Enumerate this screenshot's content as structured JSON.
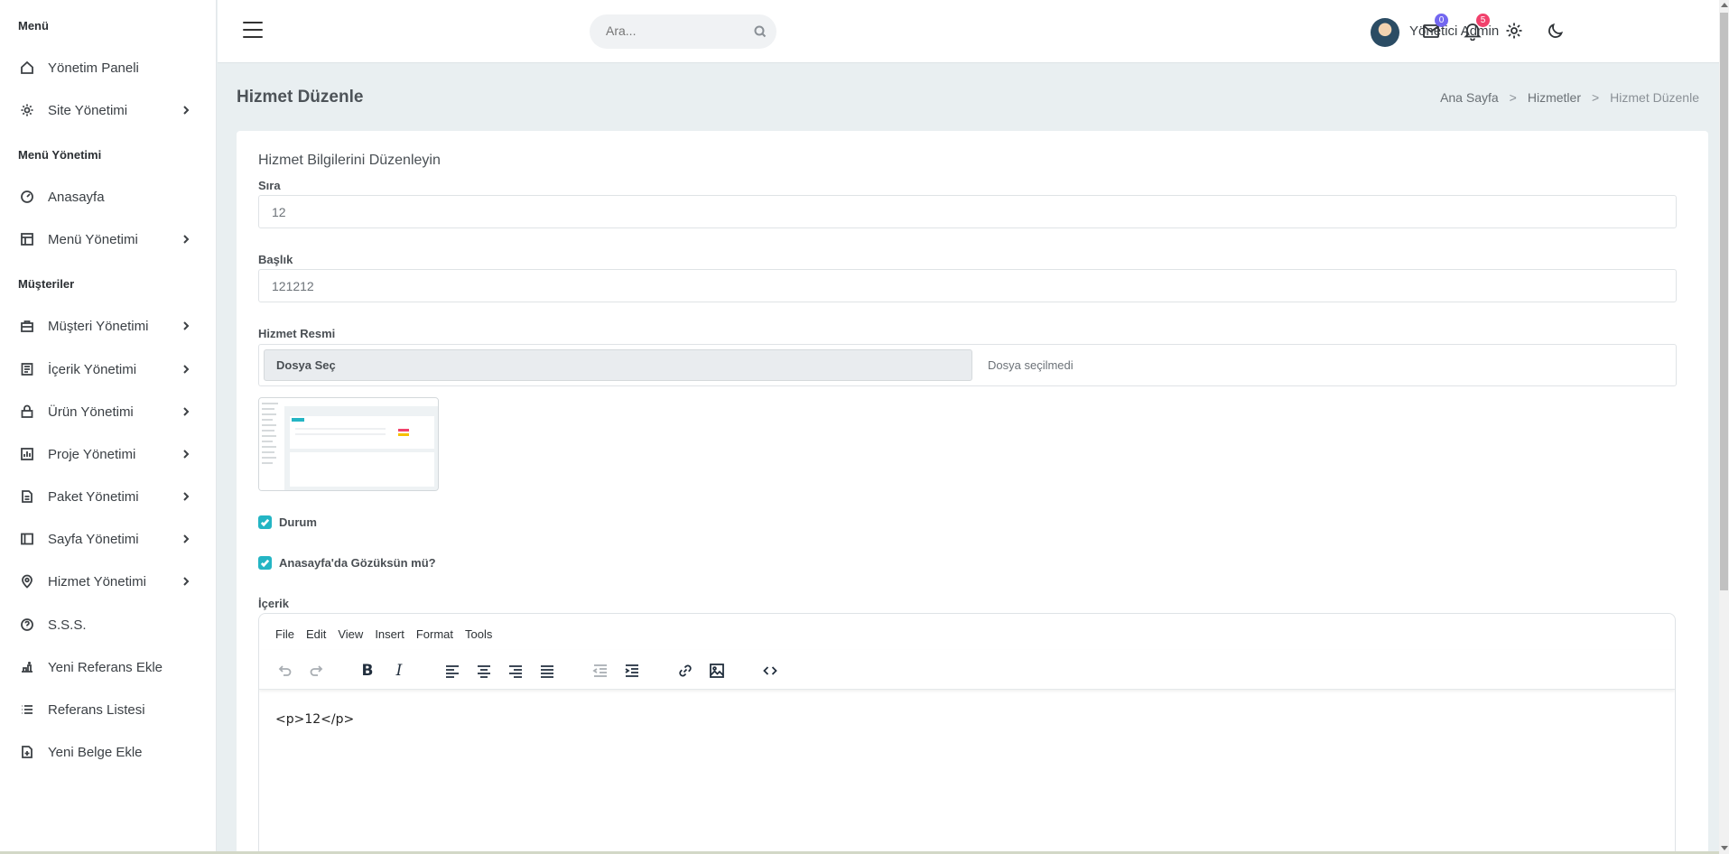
{
  "sidebar": {
    "sections": [
      "Menü",
      "Menü Yönetimi",
      "Müşteriler"
    ],
    "items": [
      {
        "label": "Yönetim Paneli",
        "icon": "home-icon",
        "chevron": false
      },
      {
        "label": "Site Yönetimi",
        "icon": "gear-icon",
        "chevron": true
      },
      {
        "label": "Anasayfa",
        "icon": "dashboard-icon",
        "chevron": false
      },
      {
        "label": "Menü Yönetimi",
        "icon": "layout-icon",
        "chevron": true
      },
      {
        "label": "Müşteri Yönetimi",
        "icon": "briefcase-icon",
        "chevron": true
      },
      {
        "label": "İçerik Yönetimi",
        "icon": "content-icon",
        "chevron": true
      },
      {
        "label": "Ürün Yönetimi",
        "icon": "lock-bag-icon",
        "chevron": true
      },
      {
        "label": "Proje Yönetimi",
        "icon": "bar-chart-icon",
        "chevron": true
      },
      {
        "label": "Paket Yönetimi",
        "icon": "document-icon",
        "chevron": true
      },
      {
        "label": "Sayfa Yönetimi",
        "icon": "sidebar-layout-icon",
        "chevron": true
      },
      {
        "label": "Hizmet Yönetimi",
        "icon": "map-pin-icon",
        "chevron": true
      },
      {
        "label": "S.S.S.",
        "icon": "question-icon",
        "chevron": false
      },
      {
        "label": "Yeni Referans Ekle",
        "icon": "reference-add-icon",
        "chevron": false
      },
      {
        "label": "Referans Listesi",
        "icon": "list-icon",
        "chevron": false
      },
      {
        "label": "Yeni Belge Ekle",
        "icon": "file-add-icon",
        "chevron": false
      }
    ]
  },
  "topbar": {
    "search_placeholder": "Ara...",
    "mail_count": "0",
    "notification_count": "5",
    "user_name": "Yönetici Admin",
    "mail_badge_color": "#7367f0",
    "notif_badge_color": "#f1416c"
  },
  "page": {
    "title": "Hizmet Düzenle",
    "breadcrumb": [
      "Ana Sayfa",
      "Hizmetler",
      "Hizmet Düzenle"
    ]
  },
  "form": {
    "card_title": "Hizmet Bilgilerini Düzenleyin",
    "sira_label": "Sıra",
    "sira_value": "12",
    "baslik_label": "Başlık",
    "baslik_value": "121212",
    "resim_label": "Hizmet Resmi",
    "file_button": "Dosya Seç",
    "file_status": "Dosya seçilmedi",
    "durum_label": "Durum",
    "anasayfa_label": "Anasayfa'da Gözüksün mü?",
    "icerik_label": "İçerik",
    "accent_color": "#24b5c4"
  },
  "editor": {
    "menu": [
      "File",
      "Edit",
      "View",
      "Insert",
      "Format",
      "Tools"
    ],
    "content": "<p>12</p>"
  }
}
